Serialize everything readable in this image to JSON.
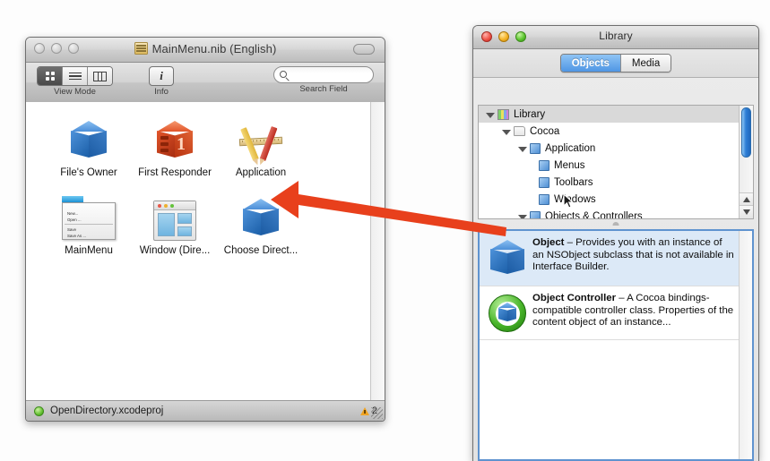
{
  "nib_window": {
    "title": "MainMenu.nib (English)",
    "title_icon": "nib-document-icon",
    "toolbar": {
      "view_mode_label": "View Mode",
      "view_modes": [
        "icon-view",
        "list-view",
        "column-view"
      ],
      "view_mode_selected": "icon-view",
      "info_label": "Info",
      "info_glyph": "i",
      "search_label": "Search Field",
      "search_value": "",
      "search_placeholder": ""
    },
    "objects": [
      {
        "label": "File's Owner",
        "icon": "blue-cube-icon"
      },
      {
        "label": "First Responder",
        "icon": "red-cube-one-icon"
      },
      {
        "label": "Application",
        "icon": "pencil-ruler-icon"
      },
      {
        "label": "MainMenu",
        "icon": "menu-icon",
        "menu_items": [
          "New...",
          "Open ...",
          "Save",
          "Save As ..."
        ]
      },
      {
        "label": "Window (Dire...",
        "icon": "window-icon"
      },
      {
        "label": "Choose Direct...",
        "icon": "blue-cube-icon"
      }
    ],
    "status": {
      "led": "green",
      "project_name": "OpenDirectory.xcodeproj",
      "warning_icon": "warning-triangle-icon",
      "warning_count": "2",
      "resize_grip": "resize-grip-icon"
    }
  },
  "library_window": {
    "title": "Library",
    "tabs": [
      {
        "label": "Objects",
        "selected": true
      },
      {
        "label": "Media",
        "selected": false
      }
    ],
    "tree": [
      {
        "label": "Library",
        "depth": 0,
        "disclosure": "open",
        "icon": "library-color-icon",
        "selected": true
      },
      {
        "label": "Cocoa",
        "depth": 1,
        "disclosure": "open",
        "icon": "folder-icon",
        "selected": false
      },
      {
        "label": "Application",
        "depth": 2,
        "disclosure": "open",
        "icon": "book-icon",
        "selected": false
      },
      {
        "label": "Menus",
        "depth": 3,
        "disclosure": "none",
        "icon": "book-icon",
        "selected": false
      },
      {
        "label": "Toolbars",
        "depth": 3,
        "disclosure": "none",
        "icon": "book-icon",
        "selected": false
      },
      {
        "label": "Windows",
        "depth": 3,
        "disclosure": "none",
        "icon": "book-icon",
        "selected": false
      },
      {
        "label": "Objects & Controllers",
        "depth": 2,
        "disclosure": "open",
        "icon": "book-icon",
        "selected": false
      }
    ],
    "cursor": "arrow-cursor",
    "objects_list": [
      {
        "icon": "blue-cube-icon",
        "name": "Object",
        "dash": " – ",
        "description": "Provides you with an instance of an NSObject subclass that is not available in Interface Builder.",
        "selected": true
      },
      {
        "icon": "green-ring-cube-icon",
        "name": "Object Controller",
        "dash": " – ",
        "description": "A Cocoa bindings-compatible controller class. Properties of the content object of an instance...",
        "selected": false
      }
    ]
  },
  "annotation": {
    "arrow_name": "orange-callout-arrow",
    "arrow_color": "#E8401C",
    "points_from": "Object row in Library list",
    "points_to": "Choose Direct... icon in nib window"
  }
}
